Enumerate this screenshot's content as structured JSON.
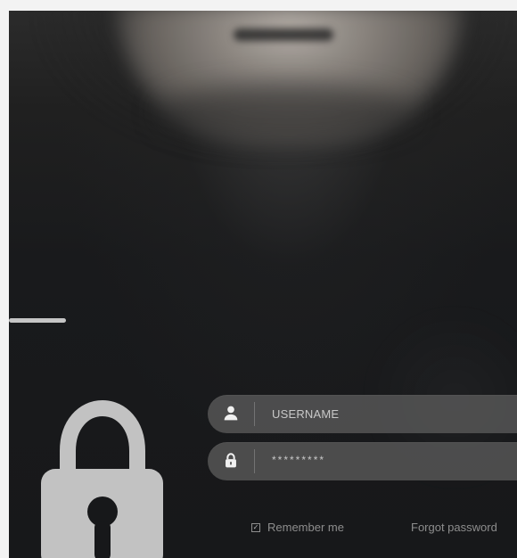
{
  "form": {
    "username_placeholder": "USERNAME",
    "password_mask": "*********",
    "remember_label": "Remember me",
    "forgot_label": "Forgot password"
  },
  "icons": {
    "hero": "lock-icon",
    "username": "user-icon",
    "password": "lock-icon"
  },
  "colors": {
    "background": "#17181a",
    "field": "#585858",
    "text": "#c8c8c8",
    "muted_text": "#8d8d8d",
    "lock": "#d5d5d5"
  }
}
